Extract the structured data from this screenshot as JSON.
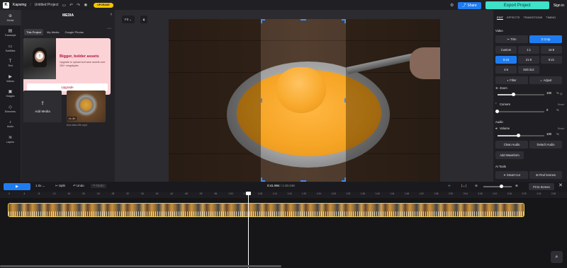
{
  "topbar": {
    "brand": "Kapwing",
    "project": "Untitled Project",
    "upgrade_label": "UPGRADE",
    "share_label": "Share",
    "export_label": "Export Project",
    "signin_label": "Sign in"
  },
  "rail": {
    "items": [
      "Media",
      "Transcript",
      "Subtitles",
      "Text",
      "Videos",
      "Images",
      "Elements",
      "Audio",
      "Layers"
    ]
  },
  "media_panel": {
    "title": "MEDIA",
    "tabs": [
      "This Project",
      "My Media",
      "Google Photos"
    ],
    "promo_title": "Bigger, bolder assets",
    "promo_text": "Upgrade to upload and save assets over 250+ megabytes",
    "promo_button": "Upgrade",
    "add_media_label": "Add Media",
    "thumb_duration": "01:30",
    "thumb_name": "test video file.mp4"
  },
  "canvas": {
    "fit_label": "Fit"
  },
  "props": {
    "tabs": [
      "EDIT",
      "EFFECTS",
      "TRANSITIONS",
      "TIMING"
    ],
    "video_label": "Video",
    "trim_label": "Trim",
    "crop_label": "Crop",
    "ratios": [
      "Custom",
      "1:1",
      "16:9",
      "9:16",
      "21:9",
      "9:21",
      "4:5",
      "820:312"
    ],
    "filter_label": "Filter",
    "adjust_label": "Adjust",
    "zoom_label": "Zoom",
    "zoom_value": "100",
    "zoom_unit": "%",
    "zoom_level": 0.35,
    "corners_label": "Corners",
    "corners_value": "0",
    "corners_unit": "%",
    "corners_level": 0,
    "reset_label": "Reset",
    "audio_label": "Audio",
    "volume_label": "Volume",
    "volume_value": "100",
    "volume_unit": "%",
    "volume_level": 0.45,
    "clean_audio_label": "Clean Audio",
    "detach_audio_label": "Detach Audio",
    "add_waveform_label": "Add Waveform",
    "ai_tools_label": "AI Tools",
    "smart_cut_label": "Smart Cut",
    "find_scenes_label": "Find Scenes"
  },
  "timeline": {
    "play_label": "▶",
    "speed_label": "1.0x",
    "split_label": "Split",
    "undo_label": "Undo",
    "redo_label": "Redo",
    "current_time": "0:41.994",
    "total_time": "/ 1:30.048",
    "fit_screen_label": "Fit to Screen",
    "zoom_level": 0.6,
    "ruler_ticks": [
      "0",
      ":4",
      ":8",
      ":12",
      ":16",
      ":20",
      ":24",
      ":28",
      ":32",
      ":36",
      ":40",
      ":44",
      ":48",
      ":52",
      ":56",
      "1:00",
      "1:04",
      "1:08",
      "1:12",
      "1:16",
      "1:20",
      "1:24",
      "1:28",
      "1:32",
      "1:36",
      "1:40",
      "1:44",
      "1:48",
      "1:52",
      "1:56",
      "2:00",
      "2:04",
      "2:08",
      "2:12",
      "2:16",
      "2:20",
      "2:24",
      "2:28"
    ]
  }
}
